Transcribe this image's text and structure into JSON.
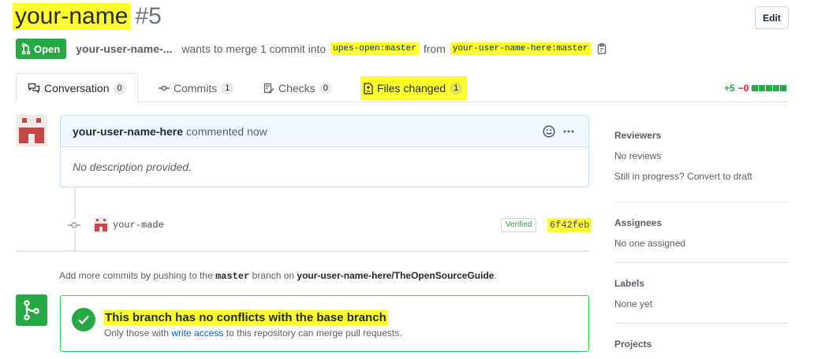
{
  "pr": {
    "title": "your-name",
    "number": "#5",
    "edit_label": "Edit",
    "state_label": "Open",
    "author": "your-user-name-...",
    "merge_text": "wants to merge 1 commit into",
    "base_branch": "upes-open:master",
    "from_text": "from",
    "head_branch": "your-user-name-here:master"
  },
  "tabs": [
    {
      "label": "Conversation",
      "count": "0"
    },
    {
      "label": "Commits",
      "count": "1"
    },
    {
      "label": "Checks",
      "count": "0"
    },
    {
      "label": "Files changed",
      "count": "1"
    }
  ],
  "diffstat": {
    "additions": "+5",
    "deletions": "−0"
  },
  "comment": {
    "author": "your-user-name-here",
    "action": "commented now",
    "body": "No description provided."
  },
  "commit": {
    "message": "your-made",
    "verified_label": "Verified",
    "sha": "6f42feb"
  },
  "push_hint": {
    "prefix": "Add more commits by pushing to the",
    "branch": "master",
    "middle": "branch on",
    "repo": "your-user-name-here/TheOpenSourceGuide",
    "suffix": "."
  },
  "merge": {
    "title": "This branch has no conflicts with the base branch",
    "sub_prefix": "Only those with",
    "sub_link": "write access",
    "sub_suffix": "to this repository can merge pull requests."
  },
  "sidebar": {
    "reviewers": {
      "heading": "Reviewers",
      "line1": "No reviews",
      "line2": "Still in progress? Convert to draft"
    },
    "assignees": {
      "heading": "Assignees",
      "line1": "No one assigned"
    },
    "labels": {
      "heading": "Labels",
      "line1": "None yet"
    },
    "projects": {
      "heading": "Projects"
    }
  },
  "colors": {
    "highlight": "#ffff2e",
    "success": "#28a745",
    "link": "#0366d6",
    "danger": "#cb2431"
  }
}
